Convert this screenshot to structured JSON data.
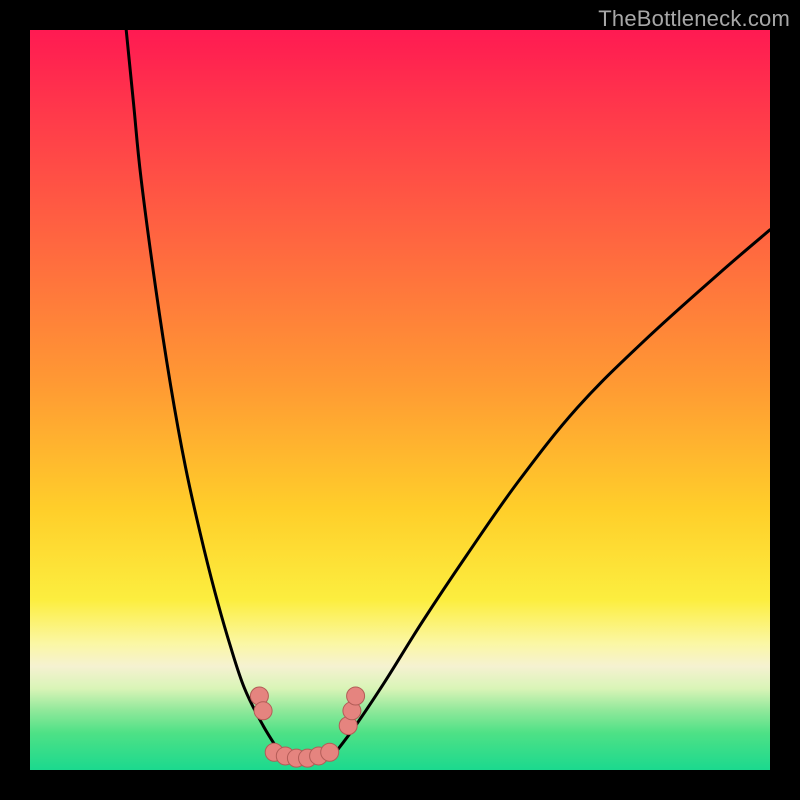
{
  "watermark": "TheBottleneck.com",
  "chart_data": {
    "type": "line",
    "title": "",
    "xlabel": "",
    "ylabel": "",
    "xlim": [
      0,
      100
    ],
    "ylim": [
      0,
      100
    ],
    "series": [
      {
        "name": "left-curve",
        "x": [
          13,
          14,
          15,
          17,
          19,
          21,
          23,
          25,
          27,
          29,
          31.5,
          34
        ],
        "y": [
          100,
          90,
          80,
          65,
          52,
          41,
          32,
          24,
          17,
          11,
          6,
          2
        ]
      },
      {
        "name": "right-curve",
        "x": [
          41,
          44,
          48,
          53,
          59,
          66,
          74,
          83,
          93,
          100
        ],
        "y": [
          2,
          6,
          12,
          20,
          29,
          39,
          49,
          58,
          67,
          73
        ]
      },
      {
        "name": "flat-minimum",
        "x": [
          34,
          35,
          36,
          37,
          38,
          39,
          40,
          41
        ],
        "y": [
          2,
          1.4,
          1.1,
          1,
          1,
          1.1,
          1.4,
          2
        ]
      }
    ],
    "markers": [
      {
        "name": "left-marker-1",
        "x": 31,
        "y": 10
      },
      {
        "name": "left-marker-2",
        "x": 31.5,
        "y": 8
      },
      {
        "name": "bottom-marker-1",
        "x": 33,
        "y": 2.4
      },
      {
        "name": "bottom-marker-2",
        "x": 34.5,
        "y": 1.9
      },
      {
        "name": "bottom-marker-3",
        "x": 36,
        "y": 1.6
      },
      {
        "name": "bottom-marker-4",
        "x": 37.5,
        "y": 1.6
      },
      {
        "name": "bottom-marker-5",
        "x": 39,
        "y": 1.9
      },
      {
        "name": "bottom-marker-6",
        "x": 40.5,
        "y": 2.4
      },
      {
        "name": "right-marker-1",
        "x": 43,
        "y": 6
      },
      {
        "name": "right-marker-2",
        "x": 43.5,
        "y": 8
      },
      {
        "name": "right-marker-3",
        "x": 44,
        "y": 10
      }
    ],
    "colors": {
      "curve": "#000000",
      "marker_fill": "#e5847f",
      "marker_stroke": "#b35c57"
    }
  }
}
